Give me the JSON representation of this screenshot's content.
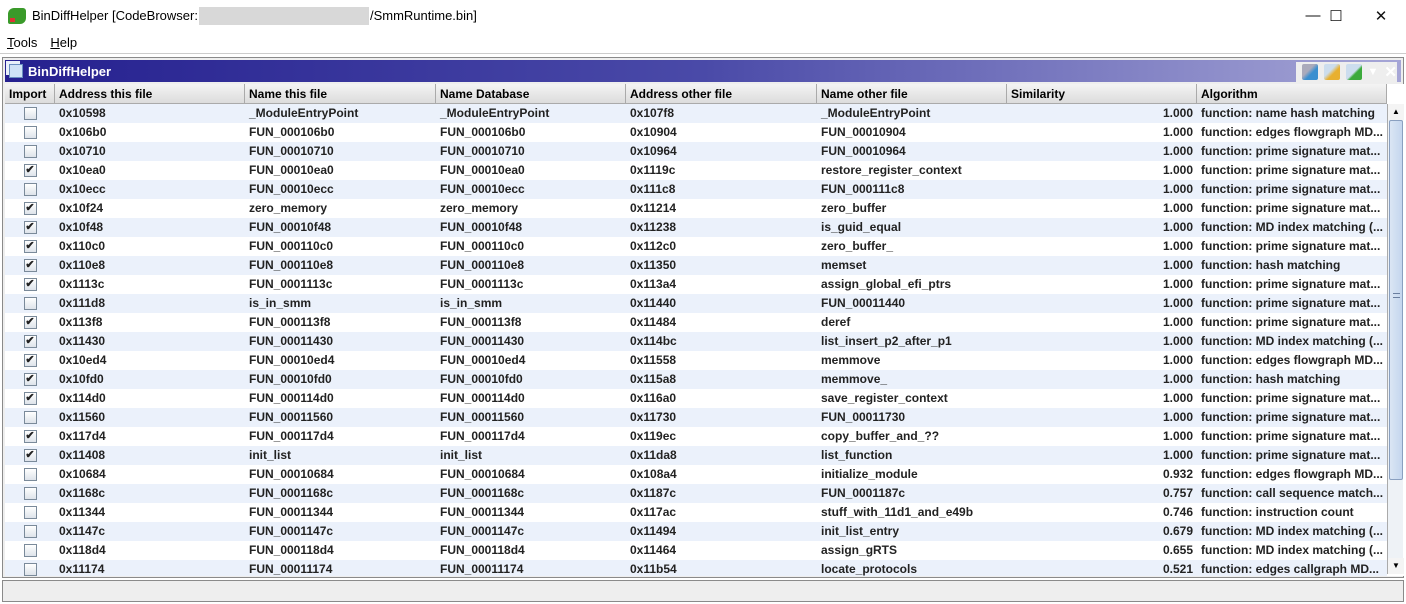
{
  "window": {
    "title_prefix": "BinDiffHelper [CodeBrowser:",
    "title_suffix": "/SmmRuntime.bin]",
    "minimize": "—",
    "maximize": "☐",
    "close": "✕"
  },
  "menu": [
    {
      "mn": "T",
      "rest": "ools"
    },
    {
      "mn": "H",
      "rest": "elp"
    }
  ],
  "panel": {
    "title": "BinDiffHelper",
    "icons": [
      "database-import-icon",
      "folder-open-icon",
      "export-icon"
    ],
    "menu_arrow": "▼",
    "close": "✕"
  },
  "columns": [
    "Import",
    "Address this file",
    "Name this file",
    "Name Database",
    "Address other file",
    "Name other file",
    "Similarity",
    "Algorithm"
  ],
  "rows": [
    [
      "",
      "0x10598",
      "_ModuleEntryPoint",
      "_ModuleEntryPoint",
      "0x107f8",
      "_ModuleEntryPoint",
      "1.000",
      "function: name hash matching"
    ],
    [
      "",
      "0x106b0",
      "FUN_000106b0",
      "FUN_000106b0",
      "0x10904",
      "FUN_00010904",
      "1.000",
      "function: edges flowgraph MD..."
    ],
    [
      "",
      "0x10710",
      "FUN_00010710",
      "FUN_00010710",
      "0x10964",
      "FUN_00010964",
      "1.000",
      "function: prime signature mat..."
    ],
    [
      "✔",
      "0x10ea0",
      "FUN_00010ea0",
      "FUN_00010ea0",
      "0x1119c",
      "restore_register_context",
      "1.000",
      "function: prime signature mat..."
    ],
    [
      "",
      "0x10ecc",
      "FUN_00010ecc",
      "FUN_00010ecc",
      "0x111c8",
      "FUN_000111c8",
      "1.000",
      "function: prime signature mat..."
    ],
    [
      "✔",
      "0x10f24",
      "zero_memory",
      "zero_memory",
      "0x11214",
      "zero_buffer",
      "1.000",
      "function: prime signature mat..."
    ],
    [
      "✔",
      "0x10f48",
      "FUN_00010f48",
      "FUN_00010f48",
      "0x11238",
      "is_guid_equal",
      "1.000",
      "function: MD index matching (..."
    ],
    [
      "✔",
      "0x110c0",
      "FUN_000110c0",
      "FUN_000110c0",
      "0x112c0",
      "zero_buffer_",
      "1.000",
      "function: prime signature mat..."
    ],
    [
      "✔",
      "0x110e8",
      "FUN_000110e8",
      "FUN_000110e8",
      "0x11350",
      "memset",
      "1.000",
      "function: hash matching"
    ],
    [
      "✔",
      "0x1113c",
      "FUN_0001113c",
      "FUN_0001113c",
      "0x113a4",
      "assign_global_efi_ptrs",
      "1.000",
      "function: prime signature mat..."
    ],
    [
      "",
      "0x111d8",
      "is_in_smm",
      "is_in_smm",
      "0x11440",
      "FUN_00011440",
      "1.000",
      "function: prime signature mat..."
    ],
    [
      "✔",
      "0x113f8",
      "FUN_000113f8",
      "FUN_000113f8",
      "0x11484",
      "deref",
      "1.000",
      "function: prime signature mat..."
    ],
    [
      "✔",
      "0x11430",
      "FUN_00011430",
      "FUN_00011430",
      "0x114bc",
      "list_insert_p2_after_p1",
      "1.000",
      "function: MD index matching (..."
    ],
    [
      "✔",
      "0x10ed4",
      "FUN_00010ed4",
      "FUN_00010ed4",
      "0x11558",
      "memmove",
      "1.000",
      "function: edges flowgraph MD..."
    ],
    [
      "✔",
      "0x10fd0",
      "FUN_00010fd0",
      "FUN_00010fd0",
      "0x115a8",
      "memmove_",
      "1.000",
      "function: hash matching"
    ],
    [
      "✔",
      "0x114d0",
      "FUN_000114d0",
      "FUN_000114d0",
      "0x116a0",
      "save_register_context",
      "1.000",
      "function: prime signature mat..."
    ],
    [
      "",
      "0x11560",
      "FUN_00011560",
      "FUN_00011560",
      "0x11730",
      "FUN_00011730",
      "1.000",
      "function: prime signature mat..."
    ],
    [
      "✔",
      "0x117d4",
      "FUN_000117d4",
      "FUN_000117d4",
      "0x119ec",
      "copy_buffer_and_??",
      "1.000",
      "function: prime signature mat..."
    ],
    [
      "✔",
      "0x11408",
      "init_list",
      "init_list",
      "0x11da8",
      "list_function",
      "1.000",
      "function: prime signature mat..."
    ],
    [
      "",
      "0x10684",
      "FUN_00010684",
      "FUN_00010684",
      "0x108a4",
      "initialize_module",
      "0.932",
      "function: edges flowgraph MD..."
    ],
    [
      "",
      "0x1168c",
      "FUN_0001168c",
      "FUN_0001168c",
      "0x1187c",
      "FUN_0001187c",
      "0.757",
      "function: call sequence match..."
    ],
    [
      "",
      "0x11344",
      "FUN_00011344",
      "FUN_00011344",
      "0x117ac",
      "stuff_with_11d1_and_e49b",
      "0.746",
      "function: instruction count"
    ],
    [
      "",
      "0x1147c",
      "FUN_0001147c",
      "FUN_0001147c",
      "0x11494",
      "init_list_entry",
      "0.679",
      "function: MD index matching (..."
    ],
    [
      "",
      "0x118d4",
      "FUN_000118d4",
      "FUN_000118d4",
      "0x11464",
      "assign_gRTS",
      "0.655",
      "function: MD index matching (..."
    ],
    [
      "",
      "0x11174",
      "FUN_00011174",
      "FUN_00011174",
      "0x11b54",
      "locate_protocols",
      "0.521",
      "function: edges callgraph MD..."
    ]
  ],
  "scrollbar": {
    "up": "▲",
    "down": "▼"
  }
}
